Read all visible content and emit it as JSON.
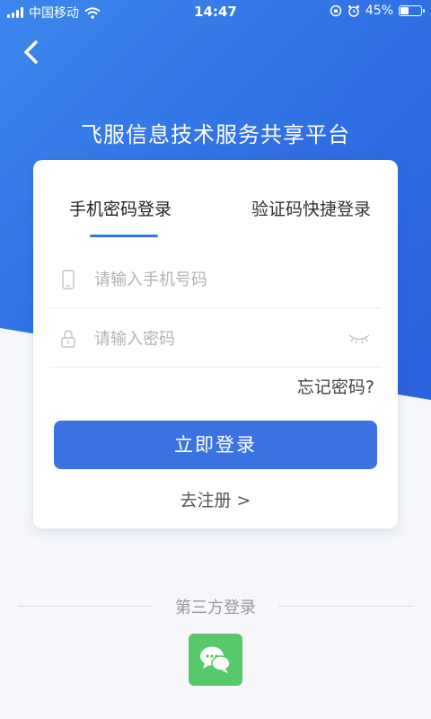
{
  "status_bar": {
    "carrier": "中国移动",
    "time": "14:47",
    "battery_percent": "45%",
    "battery_level": 0.45
  },
  "header": {
    "back_icon": "chevron-left-icon",
    "title": "飞服信息技术服务共享平台"
  },
  "login": {
    "tabs": [
      {
        "label": "手机密码登录",
        "active": true
      },
      {
        "label": "验证码快捷登录",
        "active": false
      }
    ],
    "phone": {
      "placeholder": "请输入手机号码",
      "value": "",
      "icon": "phone-icon"
    },
    "password": {
      "placeholder": "请输入密码",
      "value": "",
      "icon": "lock-icon",
      "toggle_icon": "eye-closed-icon"
    },
    "forgot_label": "忘记密码?",
    "submit_label": "立即登录",
    "register_label": "去注册 >"
  },
  "third_party": {
    "label": "第三方登录",
    "wechat_icon": "wechat-icon"
  },
  "colors": {
    "primary": "#3b72e2",
    "background_gradient": [
      "#3d86ee",
      "#2a5fdc"
    ],
    "wechat": "#58c96b"
  }
}
